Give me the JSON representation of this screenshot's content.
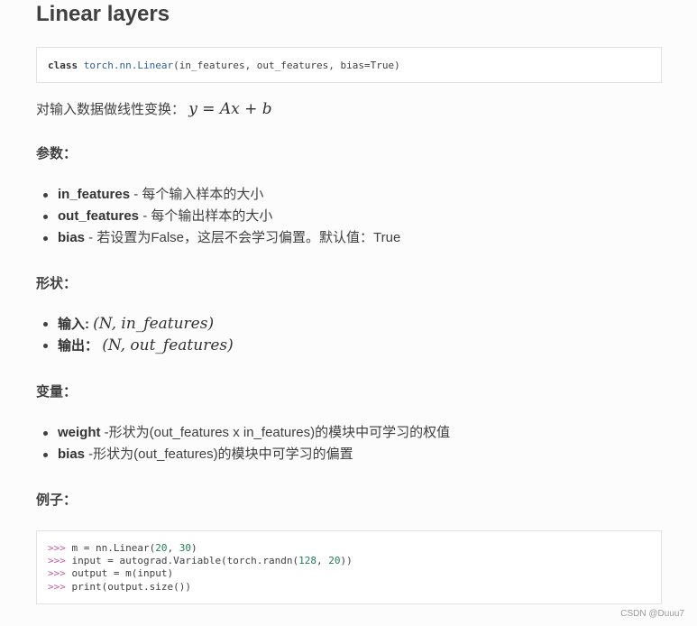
{
  "title": "Linear layers",
  "signature": {
    "keyword": "class",
    "name": "torch.nn.Linear",
    "args": "(in_features, out_features, bias=True)"
  },
  "description": {
    "text": "对输入数据做线性变换：",
    "formula": "y = Ax + b"
  },
  "params": {
    "heading": "参数：",
    "items": [
      {
        "name": "in_features",
        "desc": " - 每个输入样本的大小"
      },
      {
        "name": "out_features",
        "desc": " - 每个输出样本的大小"
      },
      {
        "name": "bias",
        "desc": " - 若设置为False，这层不会学习偏置。默认值：True"
      }
    ]
  },
  "shape": {
    "heading": "形状：",
    "items": [
      {
        "label": "输入:",
        "formula": "(N, in_features)"
      },
      {
        "label": "输出：",
        "formula": "(N, out_features)"
      }
    ]
  },
  "variables": {
    "heading": "变量：",
    "items": [
      {
        "name": "weight",
        "desc": " -形状为(out_features x in_features)的模块中可学习的权值"
      },
      {
        "name": "bias",
        "desc": " -形状为(out_features)的模块中可学习的偏置"
      }
    ]
  },
  "example": {
    "heading": "例子：",
    "prompt": ">>>",
    "lines": [
      {
        "pre": " m = nn.Linear(",
        "n1": "20",
        "mid": ", ",
        "n2": "30",
        "post": ")"
      },
      {
        "pre": " input = autograd.Variable(torch.randn(",
        "n1": "128",
        "mid": ", ",
        "n2": "20",
        "post": "))"
      },
      {
        "pre": " output = m(input)",
        "n1": "",
        "mid": "",
        "n2": "",
        "post": ""
      },
      {
        "pre": " print(output.size())",
        "n1": "",
        "mid": "",
        "n2": "",
        "post": ""
      }
    ]
  },
  "watermark": "CSDN @Duuu7"
}
